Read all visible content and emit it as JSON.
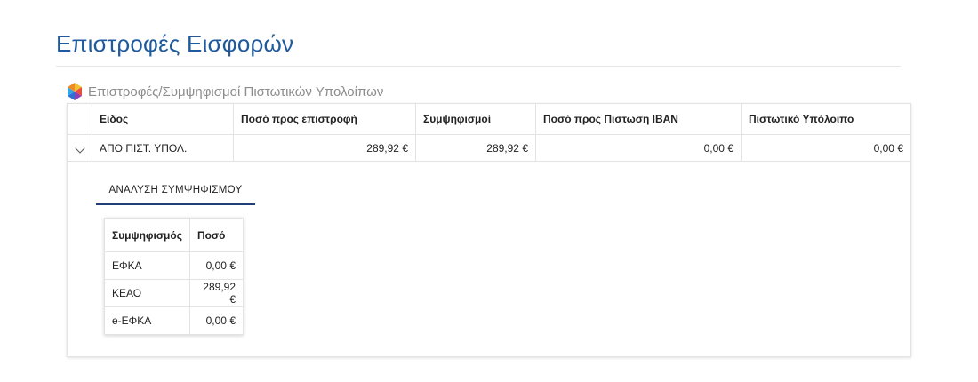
{
  "page": {
    "title": "Επιστροφές Εισφορών"
  },
  "section": {
    "icon": "multicolor-hexagon-icon",
    "title": "Επιστροφές/Συμψηφισμοί Πιστωτικών Υπολοίπων"
  },
  "main_table": {
    "headers": [
      "Είδος",
      "Ποσό προς επιστροφή",
      "Συμψηφισμοί",
      "Ποσό προς Πίστωση IBAN",
      "Πιστωτικό Υπόλοιπο"
    ],
    "rows": [
      [
        "ΑΠΟ ΠΙΣΤ. ΥΠΟΛ.",
        "289,92 €",
        "289,92 €",
        "0,00 €",
        "0,00 €"
      ]
    ]
  },
  "detail": {
    "tab_label": "ΑΝΑΛΥΣΗ ΣΥΜΨΗΦΙΣΜΟΥ",
    "headers": [
      "Συμψηφισμός",
      "Ποσό"
    ],
    "rows": [
      [
        "ΕΦΚΑ",
        "0,00 €"
      ],
      [
        "ΚΕΑΟ",
        "289,92 €"
      ],
      [
        "e-ΕΦΚΑ",
        "0,00 €"
      ]
    ]
  },
  "colors": {
    "title": "#1f5a9e",
    "tab_underline": "#1f3f7a",
    "section_title": "#8c8c8c"
  }
}
